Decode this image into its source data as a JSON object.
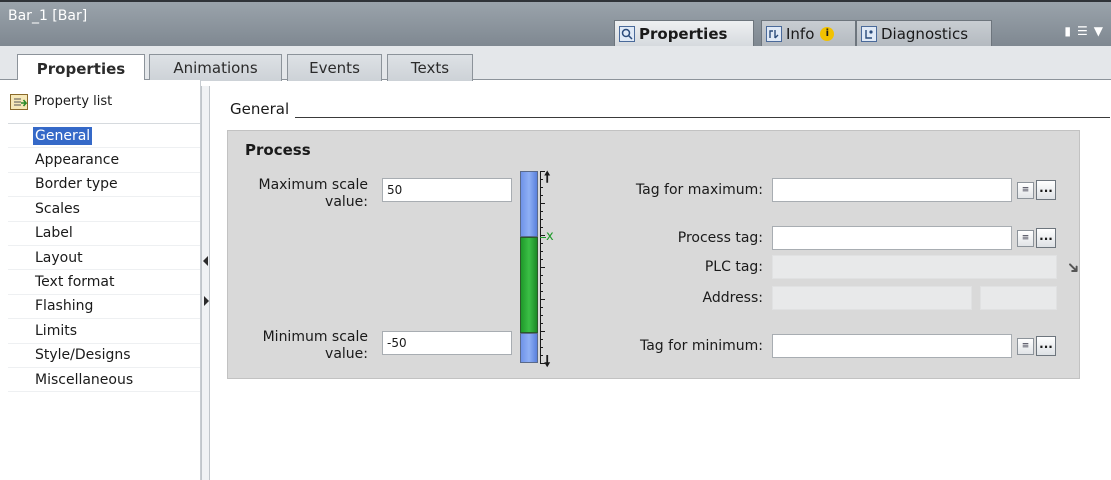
{
  "window": {
    "title": "Bar_1 [Bar]",
    "top_tabs": [
      {
        "label": "Properties",
        "icon": "properties-icon",
        "active": true
      },
      {
        "label": "Info",
        "icon": "info-icon",
        "badge": "i",
        "active": false
      },
      {
        "label": "Diagnostics",
        "icon": "diagnostics-icon",
        "active": false
      }
    ]
  },
  "subtabs": [
    "Properties",
    "Animations",
    "Events",
    "Texts"
  ],
  "nav": {
    "header": "Property list",
    "items": [
      "General",
      "Appearance",
      "Border type",
      "Scales",
      "Label",
      "Layout",
      "Text format",
      "Flashing",
      "Limits",
      "Style/Designs",
      "Miscellaneous"
    ],
    "selected": "General"
  },
  "section": {
    "heading": "General",
    "group_title": "Process",
    "max_label_1": "Maximum scale",
    "max_label_2": "value:",
    "max_value": "50",
    "min_label_1": "Minimum scale",
    "min_label_2": "value:",
    "min_value": "-50",
    "tag_max_label": "Tag for maximum:",
    "tag_max_value": "",
    "process_tag_label": "Process tag:",
    "process_tag_value": "",
    "plc_tag_label": "PLC tag:",
    "plc_tag_value": "",
    "address_label": "Address:",
    "address_value_1": "",
    "address_value_2": "",
    "tag_min_label": "Tag for minimum:",
    "tag_min_value": "",
    "bar_marker": "x",
    "dots_label": "...",
    "list_btn_label": "≡"
  },
  "colors": {
    "selected_nav": "#3569c8",
    "bar_blue": "#7a9cf0",
    "bar_green": "#2eac3a",
    "panel_bg": "#d9d9d9",
    "title_bg": "#8c949c",
    "warn": "#f2c200"
  }
}
